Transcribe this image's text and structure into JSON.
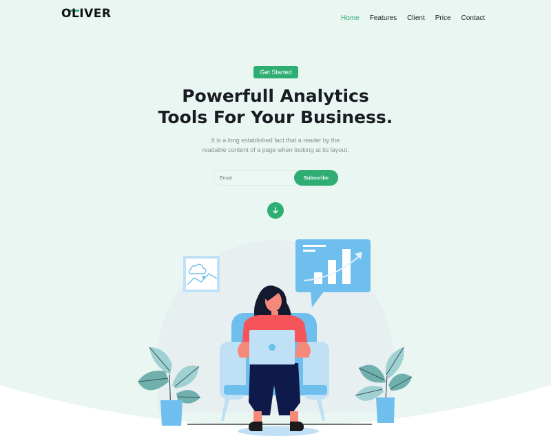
{
  "brand": {
    "logo_text": "OLIVER"
  },
  "nav": {
    "items": [
      {
        "label": "Home",
        "active": true
      },
      {
        "label": "Features",
        "active": false
      },
      {
        "label": "Client",
        "active": false
      },
      {
        "label": "Price",
        "active": false
      },
      {
        "label": "Contact",
        "active": false
      }
    ]
  },
  "hero": {
    "badge_label": "Get Started",
    "headline_line1": "Powerfull Analytics",
    "headline_line2": "Tools For Your Business.",
    "subtext_line1": "It is a long established fact that a reader by the",
    "subtext_line2": "readable content of a page when looking at its layout.",
    "email_placeholder": "Email",
    "subscribe_label": "Subscribe"
  },
  "icons": {
    "scroll_down": "arrow-down-icon",
    "picture_frame": "image-icon",
    "chart_bubble": "bar-chart-icon"
  },
  "colors": {
    "accent": "#2fae74",
    "hero_background": "#eaf6f1",
    "illustration_blue": "#6fbfee"
  }
}
